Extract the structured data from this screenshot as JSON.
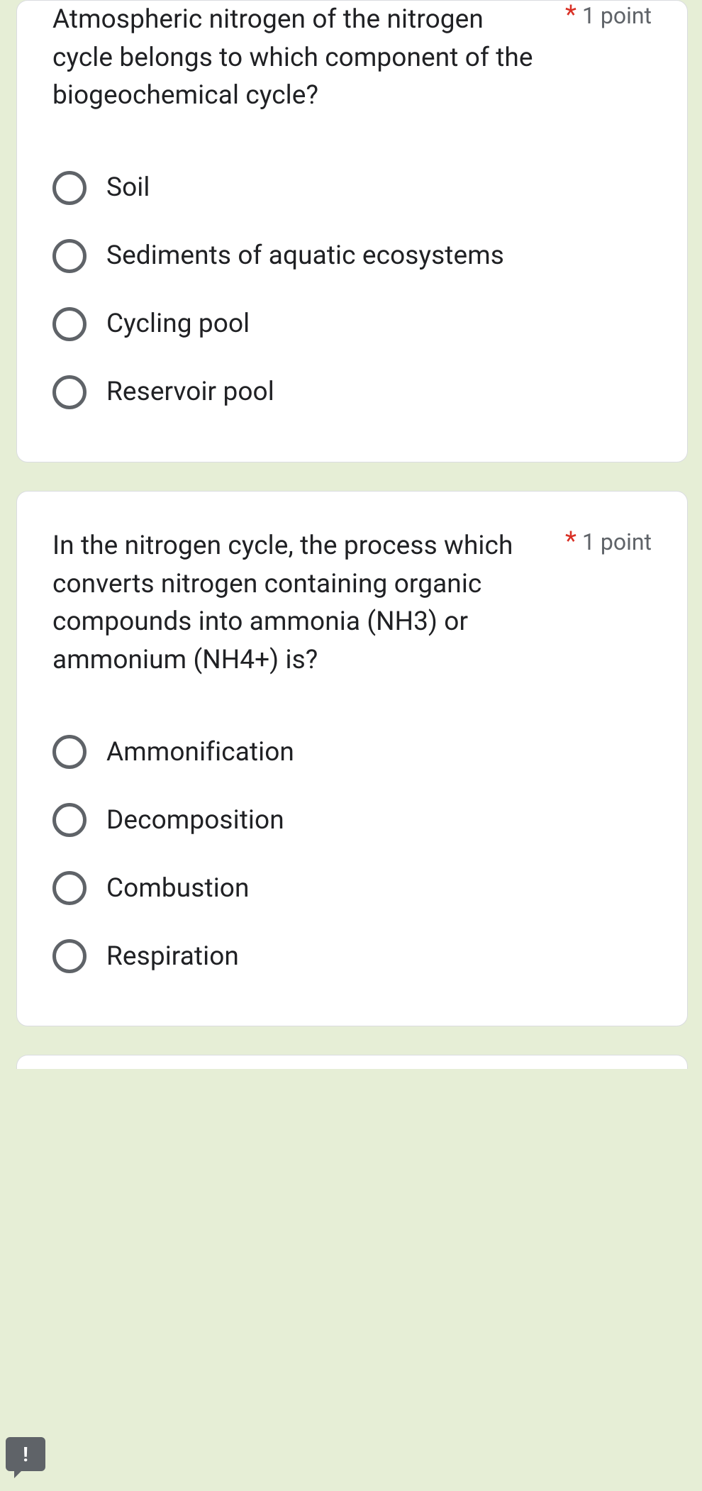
{
  "questions": [
    {
      "text": "Atmospheric nitrogen of the nitrogen cycle belongs to which component of the biogeochemical cycle?",
      "required_marker": "*",
      "points": "1 point",
      "options": [
        "Soil",
        "Sediments of aquatic ecosystems",
        "Cycling pool",
        "Reservoir pool"
      ]
    },
    {
      "text": "In the nitrogen cycle, the process which converts nitrogen containing organic compounds into ammonia (NH3) or ammonium (NH4+) is?",
      "required_marker": "*",
      "points": "1 point",
      "options": [
        "Ammonification",
        "Decomposition",
        "Combustion",
        "Respiration"
      ]
    }
  ],
  "feedback_icon": "!"
}
